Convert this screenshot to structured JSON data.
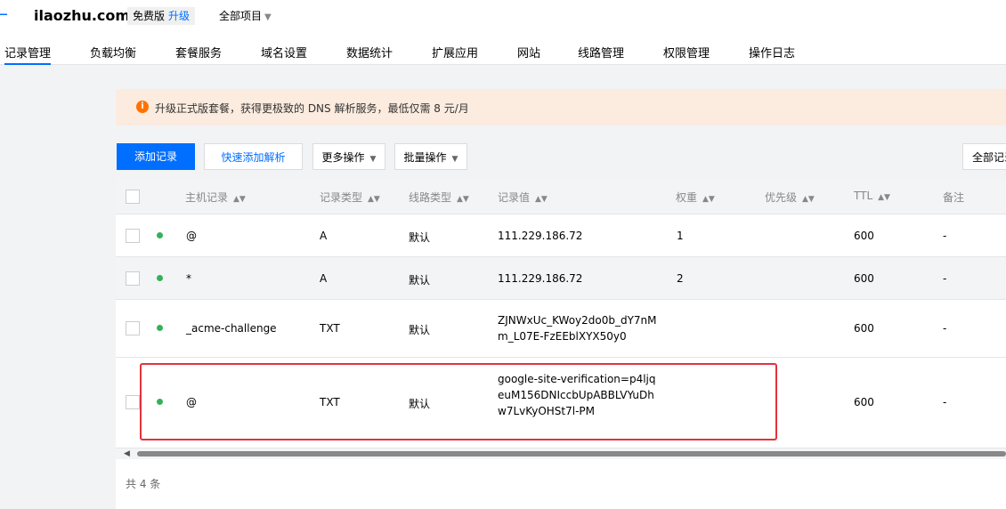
{
  "header": {
    "back_icon": "←",
    "domain": "ilaozhu.com",
    "edition": "免费版",
    "upgrade": "升级",
    "project": "全部项目"
  },
  "tabs": [
    {
      "label": "记录管理",
      "active": true
    },
    {
      "label": "负载均衡"
    },
    {
      "label": "套餐服务"
    },
    {
      "label": "域名设置"
    },
    {
      "label": "数据统计"
    },
    {
      "label": "扩展应用"
    },
    {
      "label": "网站"
    },
    {
      "label": "线路管理"
    },
    {
      "label": "权限管理"
    },
    {
      "label": "操作日志"
    }
  ],
  "notice": {
    "icon": "i",
    "text": "升级正式版套餐，获得更极致的 DNS 解析服务，最低仅需 8 元/月"
  },
  "toolbar": {
    "add_record": "添加记录",
    "quick_add": "快速添加解析",
    "more_actions": "更多操作",
    "batch_actions": "批量操作",
    "filter_all": "全部记录"
  },
  "table": {
    "columns": [
      "主机记录",
      "记录类型",
      "线路类型",
      "记录值",
      "权重",
      "优先级",
      "TTL",
      "备注"
    ],
    "rows": [
      {
        "host": "@",
        "type": "A",
        "line": "默认",
        "value": "111.229.186.72",
        "weight": "1",
        "priority": "",
        "ttl": "600",
        "remark": "-"
      },
      {
        "host": "*",
        "type": "A",
        "line": "默认",
        "value": "111.229.186.72",
        "weight": "2",
        "priority": "",
        "ttl": "600",
        "remark": "-"
      },
      {
        "host": "_acme-challenge",
        "type": "TXT",
        "line": "默认",
        "value": "ZJNWxUc_KWoy2do0b_dY7nMm_L07E-FzEEblXYX50y0",
        "weight": "",
        "priority": "",
        "ttl": "600",
        "remark": "-"
      },
      {
        "host": "@",
        "type": "TXT",
        "line": "默认",
        "value": "google-site-verification=p4ljqeuM156DNIccbUpABBLVYuDhw7LvKyOHSt7l-PM",
        "weight": "",
        "priority": "",
        "ttl": "600",
        "remark": "-"
      }
    ]
  },
  "footer": {
    "total": "共 4 条"
  },
  "colors": {
    "accent": "#006eff",
    "status_dot": "#34b15b",
    "highlight": "#e5313b",
    "notice_bg": "#fcebdf"
  }
}
